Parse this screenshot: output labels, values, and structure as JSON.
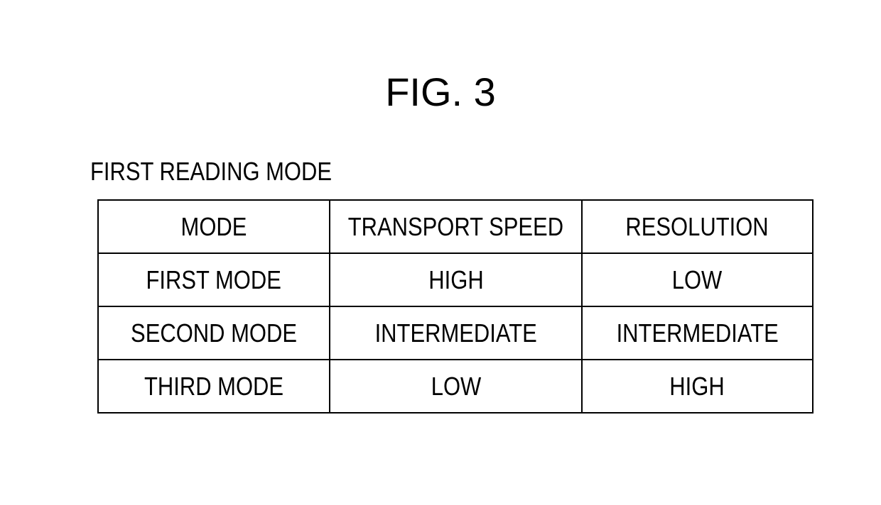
{
  "figure": {
    "title": "FIG. 3",
    "caption": "FIRST READING MODE"
  },
  "table": {
    "headers": [
      "MODE",
      "TRANSPORT SPEED",
      "RESOLUTION"
    ],
    "rows": [
      [
        "FIRST MODE",
        "HIGH",
        "LOW"
      ],
      [
        "SECOND MODE",
        "INTERMEDIATE",
        "INTERMEDIATE"
      ],
      [
        "THIRD MODE",
        "LOW",
        "HIGH"
      ]
    ]
  }
}
